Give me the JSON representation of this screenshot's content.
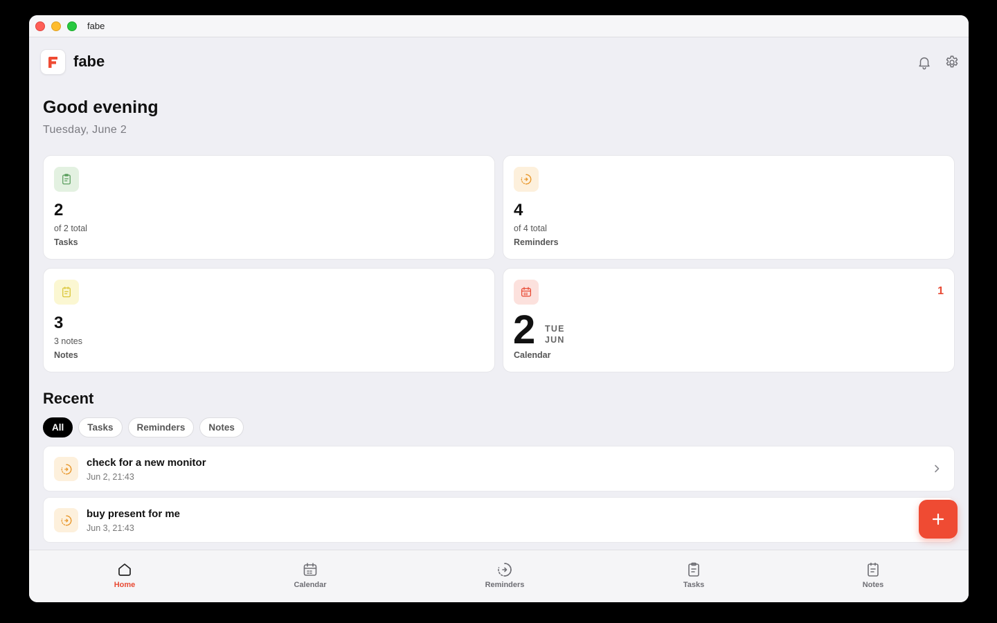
{
  "window": {
    "title": "fabe"
  },
  "header": {
    "app_name": "fabe",
    "logo_letter": "F"
  },
  "greeting": "Good evening",
  "date": "Tuesday, June 2",
  "cards": {
    "tasks": {
      "value": "2",
      "subtitle": "of 2 total",
      "label": "Tasks",
      "icon": "clipboard-icon",
      "color": "#5a9e5d"
    },
    "reminders": {
      "value": "4",
      "subtitle": "of 4 total",
      "label": "Reminders",
      "icon": "reminder-icon",
      "color": "#e8962a"
    },
    "notes": {
      "value": "3",
      "subtitle": "3 notes",
      "label": "Notes",
      "icon": "note-icon",
      "color": "#d9c433"
    },
    "calendar": {
      "day": "2",
      "weekday": "TUE",
      "month": "JUN",
      "count": "1",
      "label": "Calendar",
      "icon": "calendar-icon",
      "color": "#e84a34"
    }
  },
  "recent": {
    "title": "Recent",
    "filters": [
      "All",
      "Tasks",
      "Reminders",
      "Notes"
    ],
    "active_filter": "All",
    "items": [
      {
        "title": "check for a new monitor",
        "time": "Jun 2, 21:43",
        "icon": "reminder-icon"
      },
      {
        "title": "buy present for me",
        "time": "Jun 3, 21:43",
        "icon": "reminder-icon"
      }
    ]
  },
  "tabs": [
    {
      "label": "Home",
      "icon": "home-icon",
      "active": true
    },
    {
      "label": "Calendar",
      "icon": "calendar-icon",
      "active": false
    },
    {
      "label": "Reminders",
      "icon": "reminder-icon",
      "active": false
    },
    {
      "label": "Tasks",
      "icon": "clipboard-icon",
      "active": false
    },
    {
      "label": "Notes",
      "icon": "note-icon",
      "active": false
    }
  ],
  "colors": {
    "accent": "#ef4b33",
    "background": "#efeff4"
  }
}
